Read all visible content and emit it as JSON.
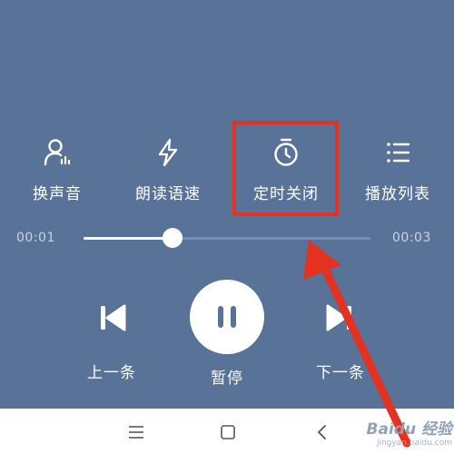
{
  "features": [
    {
      "label": "换声音",
      "icon": "voice-person-icon"
    },
    {
      "label": "朗读语速",
      "icon": "lightning-icon"
    },
    {
      "label": "定时关闭",
      "icon": "timer-icon"
    },
    {
      "label": "播放列表",
      "icon": "playlist-icon"
    }
  ],
  "progress": {
    "current_time": "00:01",
    "total_time": "00:03",
    "position_percent": 31
  },
  "controls": {
    "prev_label": "上一条",
    "play_label": "暂停",
    "next_label": "下一条"
  },
  "nav": {
    "menu_icon": "menu-icon",
    "home_icon": "home-square-icon",
    "back_icon": "back-chevron-icon"
  },
  "watermark": {
    "text": "Baidu 经验",
    "sub": "jingyan.baidu.com"
  },
  "colors": {
    "background": "#587298",
    "highlight": "#e3321f",
    "nav_bar": "#ffffff"
  }
}
